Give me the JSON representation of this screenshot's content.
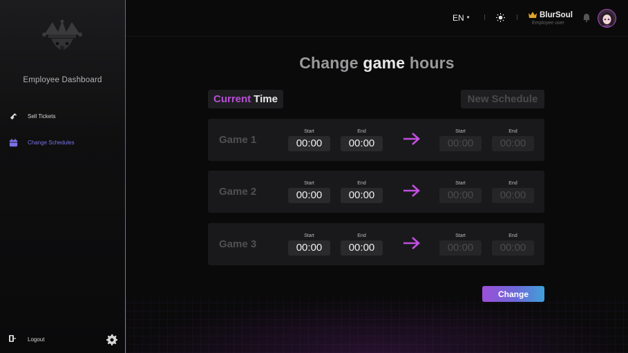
{
  "sidebar": {
    "title": "Employee Dashboard",
    "items": [
      {
        "label": "Sell Tickets",
        "icon": "ticket-icon"
      },
      {
        "label": "Change Schedules",
        "icon": "calendar-icon",
        "active": true
      }
    ],
    "logout_label": "Logout"
  },
  "header": {
    "language": "EN",
    "user_name": "BlurSoul",
    "user_role": "Employee user"
  },
  "main": {
    "title_pre": "Change ",
    "title_highlight": "game",
    "title_post": " hours",
    "current_tag_accent": "Current",
    "current_tag_rest": "Time",
    "new_tag": "New Schedule",
    "start_label": "Start",
    "end_label": "End",
    "games": [
      {
        "name": "Game 1",
        "current_start": "00:00",
        "current_end": "00:00",
        "new_start_placeholder": "00:00",
        "new_end_placeholder": "00:00"
      },
      {
        "name": "Game 2",
        "current_start": "00:00",
        "current_end": "00:00",
        "new_start_placeholder": "00:00",
        "new_end_placeholder": "00:00"
      },
      {
        "name": "Game 3",
        "current_start": "00:00",
        "current_end": "00:00",
        "new_start_placeholder": "00:00",
        "new_end_placeholder": "00:00"
      }
    ],
    "change_button": "Change"
  },
  "colors": {
    "accent_purple": "#b84fd6",
    "accent_blue": "#3fa2d9",
    "active_nav": "#7a73e8"
  }
}
